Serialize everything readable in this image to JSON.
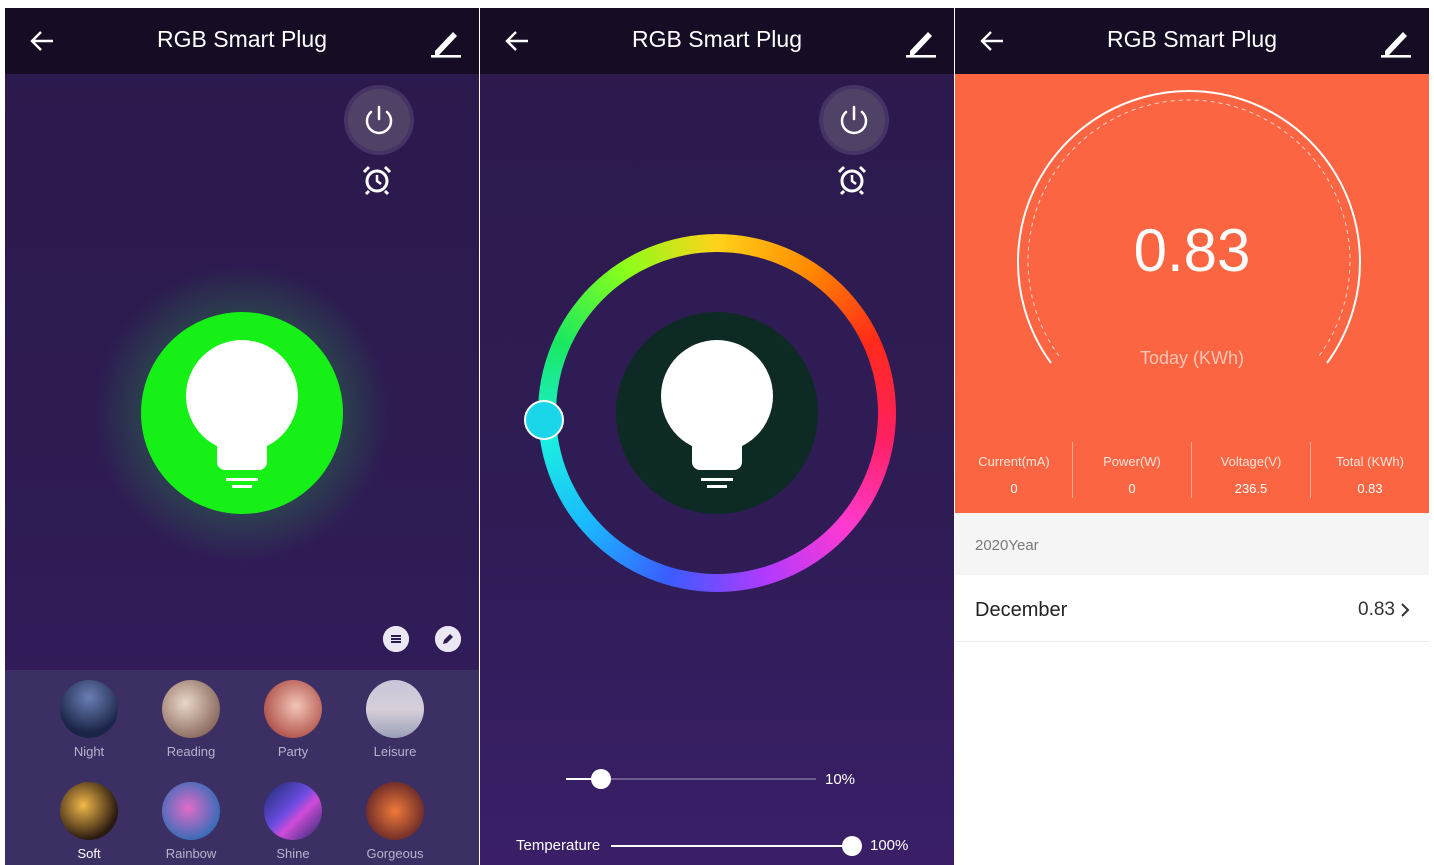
{
  "app_title": "RGB Smart Plug",
  "colors": {
    "header_bg": "#160c24",
    "panel_bg": "#2d1b52",
    "bulb_green": "#16f016",
    "gauge_orange": "#fc6541",
    "knob_cyan": "#1ad6e8"
  },
  "icons": {
    "back": "arrow-left-icon",
    "edit": "pencil-icon",
    "power": "power-icon",
    "alarm": "alarm-clock-icon",
    "bulb": "light-bulb-icon",
    "list": "list-icon",
    "chevron": "chevron-right-icon"
  },
  "panel1": {
    "scenes": [
      {
        "label": "Night"
      },
      {
        "label": "Reading"
      },
      {
        "label": "Party"
      },
      {
        "label": "Leisure"
      },
      {
        "label": "Soft",
        "selected": true
      },
      {
        "label": "Rainbow"
      },
      {
        "label": "Shine"
      },
      {
        "label": "Gorgeous"
      }
    ]
  },
  "panel2": {
    "brightness_value": "10%",
    "brightness_fraction": 0.1,
    "temperature_label": "Temperature",
    "temperature_value": "100%",
    "temperature_fraction": 1.0
  },
  "panel3": {
    "gauge_value": "0.83",
    "gauge_label": "Today (KWh)",
    "stats": [
      {
        "label": "Current(mA)",
        "value": "0"
      },
      {
        "label": "Power(W)",
        "value": "0"
      },
      {
        "label": "Voltage(V)",
        "value": "236.5"
      },
      {
        "label": "Total (KWh)",
        "value": "0.83"
      }
    ],
    "year_label": "2020Year",
    "month_row": {
      "month": "December",
      "value": "0.83"
    }
  }
}
